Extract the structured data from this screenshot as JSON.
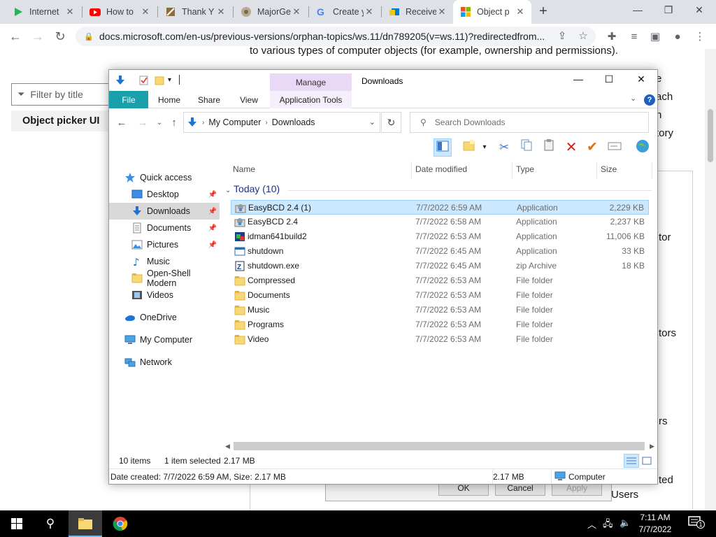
{
  "browser": {
    "tabs": [
      {
        "title": "Internet",
        "icon": "play-icon",
        "color": "#1db954"
      },
      {
        "title": "How to",
        "icon": "youtube-icon",
        "color": "#ff0000"
      },
      {
        "title": "Thank Y",
        "icon": "app-icon",
        "color": "#8a6d3b"
      },
      {
        "title": "MajorGe",
        "icon": "majorgeeks-icon",
        "color": "#7a6a50"
      },
      {
        "title": "Create y",
        "icon": "google-icon",
        "color": "#4285f4"
      },
      {
        "title": "Receive",
        "icon": "outlook-icon",
        "color": "#0078d4"
      },
      {
        "title": "Object p",
        "icon": "microsoft-icon",
        "color": "#f25022",
        "active": true
      }
    ],
    "url": "docs.microsoft.com/en-us/previous-versions/orphan-topics/ws.11/dn789205(v=ws.11)?redirectedfrom..."
  },
  "docs": {
    "top_text": "to various types of computer objects (for example, ownership and permissions).",
    "filter_placeholder": "Filter by title",
    "toc_item": "Object picker UI",
    "fragments": [
      "e",
      "ach",
      "n",
      "tory",
      "tor",
      "tors",
      "rs",
      "ted",
      "Users"
    ],
    "dialog_buttons": {
      "ok": "OK",
      "cancel": "Cancel",
      "apply": "Apply"
    }
  },
  "explorer": {
    "manage_tab": "Manage",
    "window_title": "Downloads",
    "ribbon_tabs": {
      "file": "File",
      "home": "Home",
      "share": "Share",
      "view": "View",
      "app_tools": "Application Tools"
    },
    "breadcrumb": [
      "My Computer",
      "Downloads"
    ],
    "search_placeholder": "Search Downloads",
    "nav": [
      {
        "label": "Quick access",
        "icon": "star-icon",
        "pinned": false
      },
      {
        "label": "Desktop",
        "icon": "desktop-icon",
        "pinned": true
      },
      {
        "label": "Downloads",
        "icon": "download-icon",
        "pinned": true,
        "selected": true
      },
      {
        "label": "Documents",
        "icon": "documents-icon",
        "pinned": true
      },
      {
        "label": "Pictures",
        "icon": "pictures-icon",
        "pinned": true
      },
      {
        "label": "Music",
        "icon": "music-icon",
        "pinned": false
      },
      {
        "label": "Open-Shell Modern",
        "icon": "folder-icon",
        "pinned": false
      },
      {
        "label": "Videos",
        "icon": "videos-icon",
        "pinned": false
      },
      {
        "label": "OneDrive",
        "icon": "cloud-icon",
        "pinned": false
      },
      {
        "label": "My Computer",
        "icon": "computer-icon",
        "pinned": false
      },
      {
        "label": "Network",
        "icon": "network-icon",
        "pinned": false
      }
    ],
    "columns": {
      "name": "Name",
      "date": "Date modified",
      "type": "Type",
      "size": "Size"
    },
    "group": "Today (10)",
    "files": [
      {
        "name": "EasyBCD 2.4 (1)",
        "date": "7/7/2022 6:59 AM",
        "type": "Application",
        "size": "2,229 KB",
        "icon": "app-installer-icon",
        "selected": true
      },
      {
        "name": "EasyBCD 2.4",
        "date": "7/7/2022 6:58 AM",
        "type": "Application",
        "size": "2,237 KB",
        "icon": "app-installer-icon"
      },
      {
        "name": "idman641build2",
        "date": "7/7/2022 6:53 AM",
        "type": "Application",
        "size": "11,006 KB",
        "icon": "idm-icon"
      },
      {
        "name": "shutdown",
        "date": "7/7/2022 6:45 AM",
        "type": "Application",
        "size": "33 KB",
        "icon": "window-app-icon"
      },
      {
        "name": "shutdown.exe",
        "date": "7/7/2022 6:45 AM",
        "type": "zip Archive",
        "size": "18 KB",
        "icon": "zip-icon"
      },
      {
        "name": "Compressed",
        "date": "7/7/2022 6:53 AM",
        "type": "File folder",
        "size": "",
        "icon": "folder-icon"
      },
      {
        "name": "Documents",
        "date": "7/7/2022 6:53 AM",
        "type": "File folder",
        "size": "",
        "icon": "folder-icon"
      },
      {
        "name": "Music",
        "date": "7/7/2022 6:53 AM",
        "type": "File folder",
        "size": "",
        "icon": "folder-icon"
      },
      {
        "name": "Programs",
        "date": "7/7/2022 6:53 AM",
        "type": "File folder",
        "size": "",
        "icon": "folder-icon"
      },
      {
        "name": "Video",
        "date": "7/7/2022 6:53 AM",
        "type": "File folder",
        "size": "",
        "icon": "folder-icon"
      }
    ],
    "status": {
      "items": "10 items",
      "selected": "1 item selected",
      "selected_size": "2.17 MB"
    },
    "details": {
      "info": "Date created: 7/7/2022 6:59 AM, Size: 2.17 MB",
      "size": "2.17 MB",
      "location": "Computer"
    }
  },
  "taskbar": {
    "time": "7:11 AM",
    "date": "7/7/2022",
    "notification_count": "1"
  },
  "colors": {
    "file_tab": "#19a0ab",
    "manage": "#ead9f6",
    "selection": "#cce8ff",
    "folder": "#f8d775",
    "taskbar": "#000000"
  }
}
